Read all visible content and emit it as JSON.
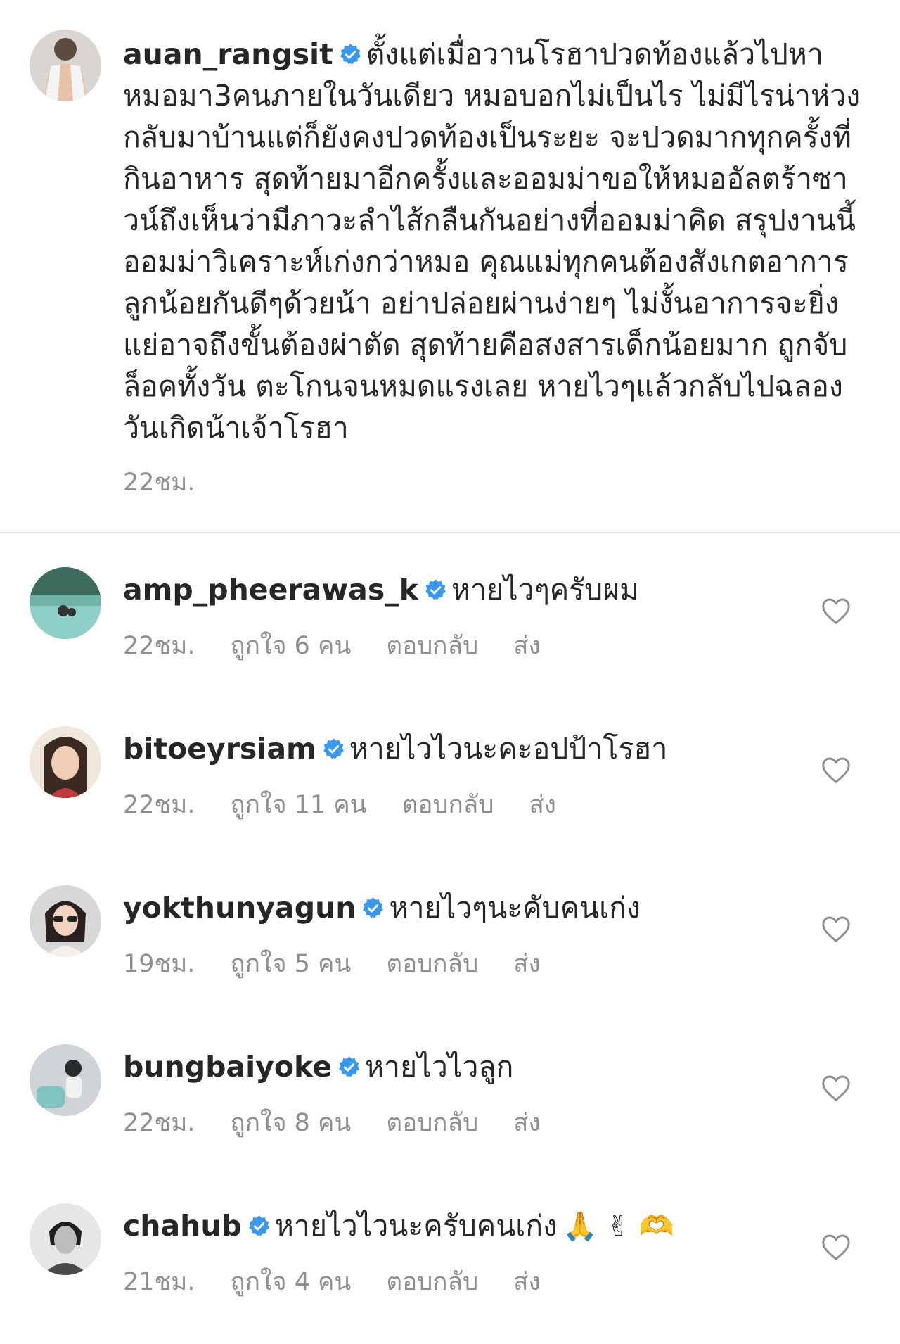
{
  "caption": {
    "username": "auan_rangsit",
    "text": "ตั้งแต่เมื่อวานโรฮาปวดท้องแล้วไปหาหมอมา3คนภายในวันเดียว หมอบอกไม่เป็นไร ไม่มีไรน่าห่วง กลับมาบ้านแต่ก็ยังคงปวดท้องเป็นระยะ จะปวดมากทุกครั้งที่กินอาหาร สุดท้ายมาอีกครั้งและออมม่าขอให้หมออัลตร้าซาวน์ถึงเห็นว่ามีภาวะลำไส้กลืนกันอย่างที่ออมม่าคิด สรุปงานนี้ออมม่าวิเคราะห์เก่งกว่าหมอ คุณแม่ทุกคนต้องสังเกตอาการลูกน้อยกันดีๆด้วยน้า อย่าปล่อยผ่านง่ายๆ ไม่งั้นอาการจะยิ่งแย่อาจถึงขั้นต้องผ่าตัด สุดท้ายคือสงสารเด็กน้อยมาก ถูกจับล็อคทั้งวัน ตะโกนจนหมดแรงเลย หายไวๆแล้วกลับไปฉลองวันเกิดน้าเจ้าโรฮา",
    "time": "22ชม."
  },
  "comments": [
    {
      "username": "amp_pheerawas_k",
      "text": "หายไวๆครับผม",
      "emoji": "",
      "time": "22ชม.",
      "likes": "ถูกใจ 6 คน",
      "reply": "ตอบกลับ",
      "send": "ส่ง"
    },
    {
      "username": "bitoeyrsiam",
      "text": "หายไวไวนะคะอปป้าโรฮา",
      "emoji": "",
      "time": "22ชม.",
      "likes": "ถูกใจ 11 คน",
      "reply": "ตอบกลับ",
      "send": "ส่ง"
    },
    {
      "username": "yokthunyagun",
      "text": "หายไวๆนะคับคนเก่ง",
      "emoji": "",
      "time": "19ชม.",
      "likes": "ถูกใจ 5 คน",
      "reply": "ตอบกลับ",
      "send": "ส่ง"
    },
    {
      "username": "bungbaiyoke",
      "text": "หายไวไวลูก",
      "emoji": "",
      "time": "22ชม.",
      "likes": "ถูกใจ 8 คน",
      "reply": "ตอบกลับ",
      "send": "ส่ง"
    },
    {
      "username": "chahub",
      "text": "หายไวไวนะครับคนเก่ง",
      "emoji": "🙏 ✌ 🫶",
      "time": "21ชม.",
      "likes": "ถูกใจ 4 คน",
      "reply": "ตอบกลับ",
      "send": "ส่ง"
    }
  ],
  "colors": {
    "verified": "#3897f0",
    "meta": "#8e8e8e",
    "text": "#262626"
  },
  "icons": {
    "verified": "verified-badge-icon",
    "like": "heart-icon"
  }
}
